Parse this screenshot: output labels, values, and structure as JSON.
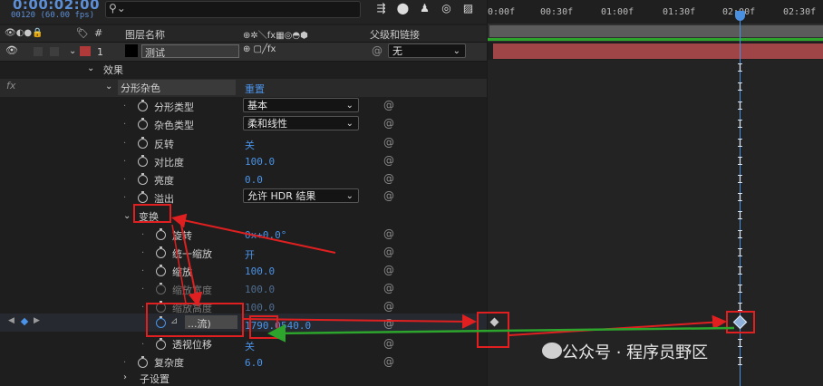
{
  "timecode": {
    "main": "0:00:02:00",
    "sub": "00120 (60.00 fps)"
  },
  "search": {
    "icon": "search-icon",
    "placeholder": ""
  },
  "columns": {
    "layer_num": "#",
    "layer_name": "图层名称",
    "parent": "父级和链接"
  },
  "ruler_ticks": [
    "0:00f",
    "00:30f",
    "01:00f",
    "01:30f",
    "02:00f",
    "02:30f"
  ],
  "layer": {
    "number": "1",
    "name": "测试",
    "parent_value": "无",
    "color": "#b03a3a"
  },
  "rows": {
    "effects": "效果",
    "fractal_noise": "分形杂色",
    "reset": "重置",
    "fx": "fx",
    "fractal_type": "分形类型",
    "fractal_type_value": "基本",
    "noise_type": "杂色类型",
    "noise_type_value": "柔和线性",
    "invert": "反转",
    "invert_value": "关",
    "contrast": "对比度",
    "contrast_value": "100.0",
    "brightness": "亮度",
    "brightness_value": "0.0",
    "overflow": "溢出",
    "overflow_value": "允许 HDR 结果",
    "transform": "变换",
    "rotation": "旋转",
    "rotation_value": "0x+0.0°",
    "uniform_scale": "统一缩放",
    "uniform_scale_value": "开",
    "scale": "缩放",
    "scale_value": "100.0",
    "scale_width": "缩放宽度",
    "scale_width_value": "100.0",
    "scale_height": "缩放高度",
    "scale_height_value": "100.0",
    "offset_label": "...流)",
    "offset_x": "1790.0",
    "offset_y": "540.0",
    "perspective": "透视位移",
    "perspective_value": "关",
    "complexity": "复杂度",
    "complexity_value": "6.0",
    "sub_settings": "子设置"
  },
  "watermark": "公众号 · 程序员野区",
  "colors": {
    "accent": "#4a93e8",
    "annotation_red": "#e02020",
    "annotation_green": "#2da52d",
    "layer_bar": "#9f4547"
  }
}
